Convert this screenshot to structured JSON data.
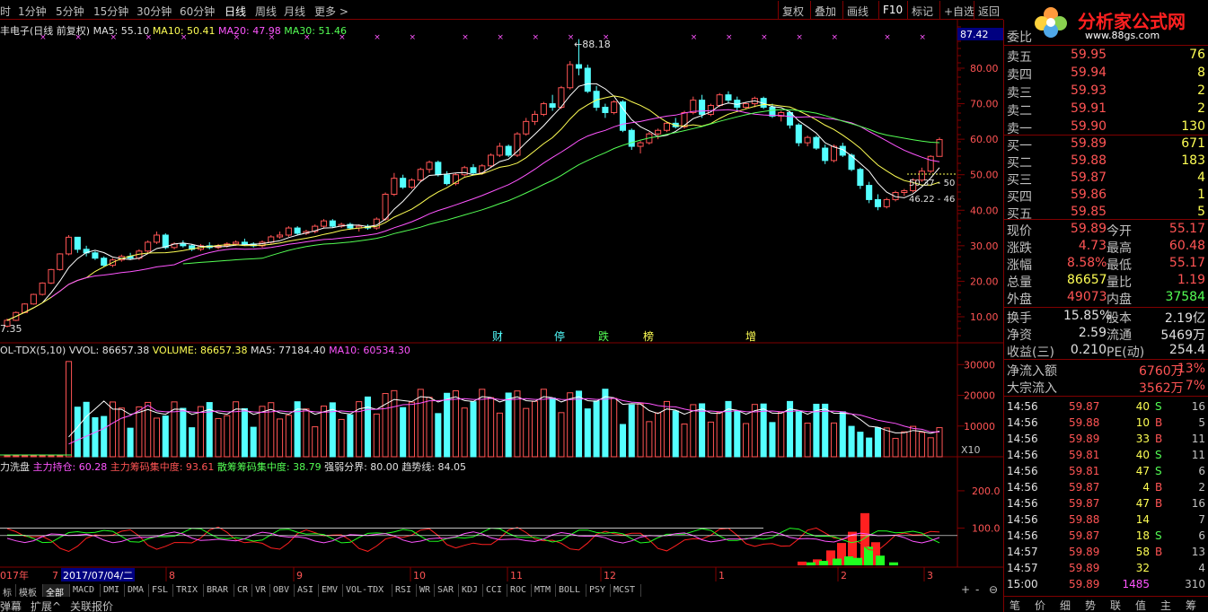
{
  "toolbar": {
    "periods": [
      "时",
      "1分钟",
      "5分钟",
      "15分钟",
      "30分钟",
      "60分钟",
      "日线",
      "周线",
      "月线",
      "更多 >"
    ],
    "active_period": "日线",
    "buttons": [
      "复权",
      "叠加",
      "画线",
      "F10",
      "标记",
      "+自选",
      "返回"
    ]
  },
  "logo": {
    "text": "分析家公式网",
    "url_text": "www.88gs.com"
  },
  "main_info": {
    "name": "丰电子(日线 前复权)",
    "ma5": "MA5: 55.10",
    "ma10": "MA10: 50.41",
    "ma20": "MA20: 47.98",
    "ma30": "MA30: 51.46"
  },
  "price_axis": {
    "top_value": "87.42",
    "ticks": [
      "80.00",
      "70.00",
      "60.00",
      "50.00",
      "40.00",
      "30.00",
      "20.00",
      "10.00"
    ],
    "high_label": "88.18",
    "low_label": "7.35",
    "line_labels": [
      "50.37 - 50",
      "46.22 - 46"
    ]
  },
  "event_markers": [
    "财",
    "停",
    "跌",
    "榜",
    "增"
  ],
  "volume_info": {
    "name": "OL-TDX(5,10)",
    "vvol": "VVOL: 86657.38",
    "volume": "VOLUME: 86657.38",
    "ma5": "MA5: 77184.40",
    "ma10": "MA10: 60534.30",
    "ticks": [
      "30000",
      "20000",
      "10000"
    ],
    "scale": "X10"
  },
  "indicator_info": {
    "name": "力洗盘",
    "l1": "主力持仓: 60.28",
    "l2": "主力筹码集中度: 93.61",
    "l3": "散筹筹码集中度: 38.79",
    "l4": "强弱分界: 80.00",
    "l5": "趋势线: 84.05",
    "ticks": [
      "200.0",
      "100.0"
    ]
  },
  "date_axis": {
    "labels": [
      "017年",
      "7",
      "2017/07/04/二",
      "8",
      "9",
      "10",
      "11",
      "12",
      "1",
      "2",
      "3"
    ]
  },
  "tabs": [
    "标",
    "模板",
    "全部",
    "MACD",
    "DMI",
    "DMA",
    "FSL",
    "TRIX",
    "BRAR",
    "CR",
    "VR",
    "OBV",
    "ASI",
    "EMV",
    "VOL-TDX",
    "RSI",
    "WR",
    "SAR",
    "KDJ",
    "CCI",
    "ROC",
    "MTM",
    "BOLL",
    "PSY",
    "MCST"
  ],
  "active_tab": "全部",
  "bottom_bar": [
    "弹幕",
    "扩展^",
    "关联报价"
  ],
  "zoom_controls": [
    "+",
    "-",
    "⊖"
  ],
  "panel": {
    "weibi_label": "委比",
    "sell": [
      {
        "label": "卖五",
        "price": "59.95",
        "vol": "76"
      },
      {
        "label": "卖四",
        "price": "59.94",
        "vol": "8"
      },
      {
        "label": "卖三",
        "price": "59.93",
        "vol": "2"
      },
      {
        "label": "卖二",
        "price": "59.91",
        "vol": "2"
      },
      {
        "label": "卖一",
        "price": "59.90",
        "vol": "130"
      }
    ],
    "buy": [
      {
        "label": "买一",
        "price": "59.89",
        "vol": "671"
      },
      {
        "label": "买二",
        "price": "59.88",
        "vol": "183"
      },
      {
        "label": "买三",
        "price": "59.87",
        "vol": "4"
      },
      {
        "label": "买四",
        "price": "59.86",
        "vol": "1"
      },
      {
        "label": "买五",
        "price": "59.85",
        "vol": "5"
      }
    ],
    "stats": [
      {
        "l1": "现价",
        "v1": "59.89",
        "l2": "今开",
        "v2": "55.17",
        "c1": "red",
        "c2": "red"
      },
      {
        "l1": "涨跌",
        "v1": "4.73",
        "l2": "最高",
        "v2": "60.48",
        "c1": "red",
        "c2": "red"
      },
      {
        "l1": "涨幅",
        "v1": "8.58%",
        "l2": "最低",
        "v2": "55.17",
        "c1": "red",
        "c2": "red"
      },
      {
        "l1": "总量",
        "v1": "86657",
        "l2": "量比",
        "v2": "1.19",
        "c1": "yellow",
        "c2": "red"
      },
      {
        "l1": "外盘",
        "v1": "49073",
        "l2": "内盘",
        "v2": "37584",
        "c1": "red",
        "c2": "green"
      }
    ],
    "stats2": [
      {
        "l1": "换手",
        "v1": "15.85%",
        "l2": "股本",
        "v2": "2.19亿"
      },
      {
        "l1": "净资",
        "v1": "2.59",
        "l2": "流通",
        "v2": "5469万"
      },
      {
        "l1": "收益(三)",
        "v1": "0.210",
        "l2": "PE(动)",
        "v2": "254.4"
      }
    ],
    "flows": [
      {
        "label": "净流入额",
        "value": "6760万",
        "pct": "13%"
      },
      {
        "label": "大宗流入",
        "value": "3562万",
        "pct": "7%"
      }
    ],
    "trades": [
      {
        "time": "14:56",
        "price": "59.87",
        "vol": "40",
        "bs": "S",
        "n": "16"
      },
      {
        "time": "14:56",
        "price": "59.88",
        "vol": "10",
        "bs": "B",
        "n": "5"
      },
      {
        "time": "14:56",
        "price": "59.89",
        "vol": "33",
        "bs": "B",
        "n": "11"
      },
      {
        "time": "14:56",
        "price": "59.81",
        "vol": "40",
        "bs": "S",
        "n": "11"
      },
      {
        "time": "14:56",
        "price": "59.81",
        "vol": "47",
        "bs": "S",
        "n": "6"
      },
      {
        "time": "14:56",
        "price": "59.87",
        "vol": "4",
        "bs": "B",
        "n": "2"
      },
      {
        "time": "14:56",
        "price": "59.87",
        "vol": "47",
        "bs": "B",
        "n": "16"
      },
      {
        "time": "14:56",
        "price": "59.88",
        "vol": "14",
        "bs": "",
        "n": "7"
      },
      {
        "time": "14:56",
        "price": "59.87",
        "vol": "18",
        "bs": "S",
        "n": "6"
      },
      {
        "time": "14:57",
        "price": "59.89",
        "vol": "58",
        "bs": "B",
        "n": "13"
      },
      {
        "time": "14:57",
        "price": "59.89",
        "vol": "32",
        "bs": "",
        "n": "4"
      },
      {
        "time": "15:00",
        "price": "59.89",
        "vol": "1485",
        "bs": "",
        "n": "310"
      }
    ],
    "bottom_tabs": [
      "笔",
      "价",
      "细",
      "势",
      "联",
      "值",
      "主",
      "筹"
    ]
  },
  "colors": {
    "up": "#ff5454",
    "down": "#54ffff",
    "ma5": "#ffffff",
    "ma10": "#ffff54",
    "ma20": "#ff55ff",
    "ma30": "#54ff54",
    "border": "#800000"
  },
  "chart_data": {
    "type": "candlestick",
    "period": "daily",
    "candles_approx": [
      [
        7.35,
        9.5,
        7.0,
        9.0
      ],
      [
        9.0,
        11.5,
        8.8,
        11.2
      ],
      [
        11.2,
        13.8,
        11.0,
        13.6
      ],
      [
        13.6,
        16.5,
        13.4,
        16.3
      ],
      [
        16.3,
        19.7,
        16.0,
        19.5
      ],
      [
        19.5,
        23.5,
        19.2,
        23.3
      ],
      [
        23.3,
        27.9,
        23.0,
        27.7
      ],
      [
        27.7,
        33.0,
        27.3,
        32.4
      ],
      [
        32.4,
        30.5,
        28.0,
        29.0
      ],
      [
        29.0,
        30.0,
        27.0,
        28.0
      ],
      [
        28.0,
        28.5,
        26.0,
        26.5
      ],
      [
        26.5,
        27.0,
        24.0,
        24.5
      ],
      [
        24.5,
        26.5,
        24.0,
        26.0
      ],
      [
        26.0,
        27.5,
        25.5,
        27.0
      ],
      [
        27.0,
        28.0,
        26.0,
        26.5
      ],
      [
        26.5,
        29.0,
        26.0,
        28.5
      ],
      [
        28.5,
        31.5,
        28.0,
        31.0
      ],
      [
        31.0,
        34.0,
        30.5,
        33.0
      ],
      [
        33.0,
        33.5,
        29.0,
        29.5
      ],
      [
        29.5,
        31.0,
        29.0,
        30.5
      ],
      [
        30.5,
        31.5,
        29.5,
        30.0
      ],
      [
        30.0,
        30.5,
        28.5,
        29.0
      ],
      [
        29.0,
        30.5,
        28.5,
        30.0
      ],
      [
        30.0,
        31.0,
        29.0,
        29.5
      ],
      [
        29.5,
        30.5,
        29.0,
        30.0
      ],
      [
        30.0,
        31.0,
        29.5,
        30.5
      ],
      [
        30.5,
        31.5,
        30.0,
        31.0
      ],
      [
        31.0,
        32.0,
        30.0,
        30.5
      ],
      [
        30.5,
        31.0,
        29.5,
        30.0
      ],
      [
        30.0,
        31.5,
        29.5,
        31.0
      ],
      [
        31.0,
        33.0,
        30.5,
        32.5
      ],
      [
        32.5,
        34.0,
        32.0,
        33.0
      ],
      [
        33.0,
        35.5,
        32.5,
        35.0
      ],
      [
        35.0,
        35.5,
        33.0,
        33.5
      ],
      [
        33.5,
        34.5,
        33.0,
        34.0
      ],
      [
        34.0,
        36.0,
        33.5,
        35.5
      ],
      [
        35.5,
        37.5,
        35.0,
        37.0
      ],
      [
        37.0,
        37.5,
        35.0,
        35.5
      ],
      [
        35.5,
        36.5,
        35.0,
        36.0
      ],
      [
        36.0,
        36.5,
        34.5,
        35.0
      ],
      [
        35.0,
        36.0,
        34.0,
        35.5
      ],
      [
        35.5,
        36.0,
        34.5,
        35.0
      ],
      [
        35.0,
        38.0,
        34.5,
        37.5
      ],
      [
        37.5,
        45.0,
        37.0,
        44.5
      ],
      [
        44.5,
        50.5,
        44.0,
        49.0
      ],
      [
        49.0,
        50.0,
        46.0,
        46.5
      ],
      [
        46.5,
        49.0,
        46.0,
        48.5
      ],
      [
        48.5,
        52.0,
        48.0,
        51.5
      ],
      [
        51.5,
        54.0,
        50.5,
        53.5
      ],
      [
        53.5,
        54.0,
        49.5,
        50.0
      ],
      [
        50.0,
        51.0,
        47.0,
        47.5
      ],
      [
        47.5,
        50.5,
        47.0,
        50.0
      ],
      [
        50.0,
        52.5,
        49.5,
        52.0
      ],
      [
        52.0,
        53.0,
        50.0,
        50.5
      ],
      [
        50.5,
        53.0,
        50.0,
        52.5
      ],
      [
        52.5,
        56.0,
        52.0,
        55.5
      ],
      [
        55.5,
        59.0,
        55.0,
        58.0
      ],
      [
        58.0,
        58.5,
        55.0,
        55.5
      ],
      [
        55.5,
        62.0,
        55.0,
        61.5
      ],
      [
        61.5,
        66.0,
        61.0,
        65.0
      ],
      [
        65.0,
        68.0,
        64.0,
        67.0
      ],
      [
        67.0,
        70.5,
        66.5,
        70.0
      ],
      [
        70.0,
        72.5,
        68.0,
        69.0
      ],
      [
        69.0,
        75.0,
        68.5,
        74.5
      ],
      [
        74.5,
        82.0,
        74.0,
        81.0
      ],
      [
        81.0,
        88.18,
        78.0,
        80.0
      ],
      [
        80.0,
        81.0,
        73.0,
        73.5
      ],
      [
        73.5,
        75.0,
        68.0,
        69.0
      ],
      [
        69.0,
        70.0,
        66.0,
        67.5
      ],
      [
        67.5,
        71.0,
        67.0,
        70.5
      ],
      [
        70.5,
        71.0,
        62.0,
        62.5
      ],
      [
        62.5,
        63.0,
        57.0,
        58.0
      ],
      [
        58.0,
        59.5,
        56.0,
        59.0
      ],
      [
        59.0,
        62.0,
        58.5,
        61.5
      ],
      [
        61.5,
        63.0,
        60.0,
        62.5
      ],
      [
        62.5,
        65.0,
        62.0,
        64.5
      ],
      [
        64.5,
        66.0,
        63.0,
        63.5
      ],
      [
        63.5,
        68.0,
        63.0,
        67.5
      ],
      [
        67.5,
        72.0,
        67.0,
        71.0
      ],
      [
        71.0,
        72.5,
        66.0,
        67.0
      ],
      [
        67.0,
        70.0,
        66.5,
        69.5
      ],
      [
        69.5,
        73.0,
        69.0,
        72.5
      ],
      [
        72.5,
        73.5,
        70.0,
        71.0
      ],
      [
        71.0,
        72.0,
        68.0,
        69.0
      ],
      [
        69.0,
        70.5,
        68.5,
        70.0
      ],
      [
        70.0,
        72.0,
        69.0,
        71.5
      ],
      [
        71.5,
        72.0,
        68.5,
        69.0
      ],
      [
        69.0,
        70.0,
        66.0,
        66.5
      ],
      [
        66.5,
        68.0,
        65.0,
        67.5
      ],
      [
        67.5,
        68.0,
        63.0,
        64.0
      ],
      [
        64.0,
        64.5,
        58.0,
        59.0
      ],
      [
        59.0,
        61.0,
        58.0,
        60.5
      ],
      [
        60.5,
        61.0,
        57.0,
        57.5
      ],
      [
        57.5,
        58.5,
        53.0,
        54.0
      ],
      [
        54.0,
        58.5,
        53.5,
        58.0
      ],
      [
        58.0,
        59.0,
        55.0,
        55.5
      ],
      [
        55.5,
        56.0,
        51.0,
        51.5
      ],
      [
        51.5,
        52.0,
        46.0,
        47.0
      ],
      [
        47.0,
        48.0,
        42.0,
        43.0
      ],
      [
        43.0,
        44.5,
        40.0,
        41.0
      ],
      [
        41.0,
        43.5,
        40.5,
        43.0
      ],
      [
        43.0,
        45.5,
        42.5,
        45.0
      ],
      [
        45.0,
        46.0,
        44.0,
        45.5
      ],
      [
        45.5,
        49.0,
        45.0,
        48.5
      ],
      [
        48.5,
        52.0,
        48.0,
        51.0
      ],
      [
        51.0,
        55.5,
        50.5,
        55.17
      ],
      [
        55.17,
        60.48,
        55.17,
        59.89
      ]
    ]
  }
}
